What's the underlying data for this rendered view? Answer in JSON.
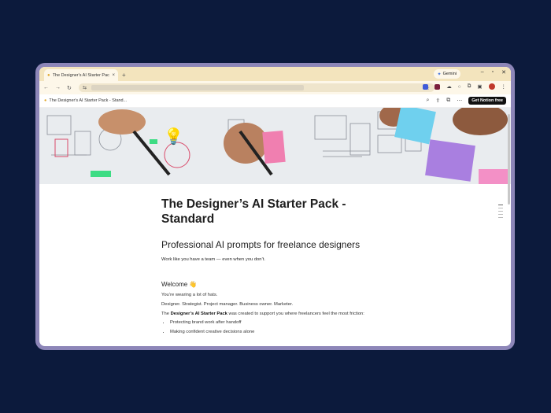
{
  "browser": {
    "tab_title": "The Designer's AI Starter Pack",
    "tab_close": "×",
    "new_tab": "+",
    "gemini_label": "Gemini"
  },
  "notion": {
    "page_breadcrumb": "The Designer's AI Starter Pack - Stand...",
    "get_notion_label": "Get Notion free"
  },
  "page": {
    "title": "The Designer’s AI Starter Pack - Standard",
    "headline": "Professional AI prompts for freelance designers",
    "tagline": "Work like you have a team — even when you don’t.",
    "welcome_heading": "Welcome 👋",
    "para1": "You’re wearing a lot of hats.",
    "para2": "Designer. Strategist. Project manager. Business owner. Marketer.",
    "para3_before": "The ",
    "para3_bold": "Designer’s AI Starter Pack",
    "para3_after": " was created to support you where freelancers feel the most friction:",
    "bullets": [
      "Protecting brand work after handoff",
      "Making confident creative decisions alone"
    ]
  },
  "icons": {
    "page_icon": "💡",
    "tab_favicon": "💡"
  },
  "colors": {
    "background": "#0c1a3c",
    "device_frame": "#8d86b8",
    "tabstrip": "#f3e4bd",
    "cta": "#111111"
  }
}
